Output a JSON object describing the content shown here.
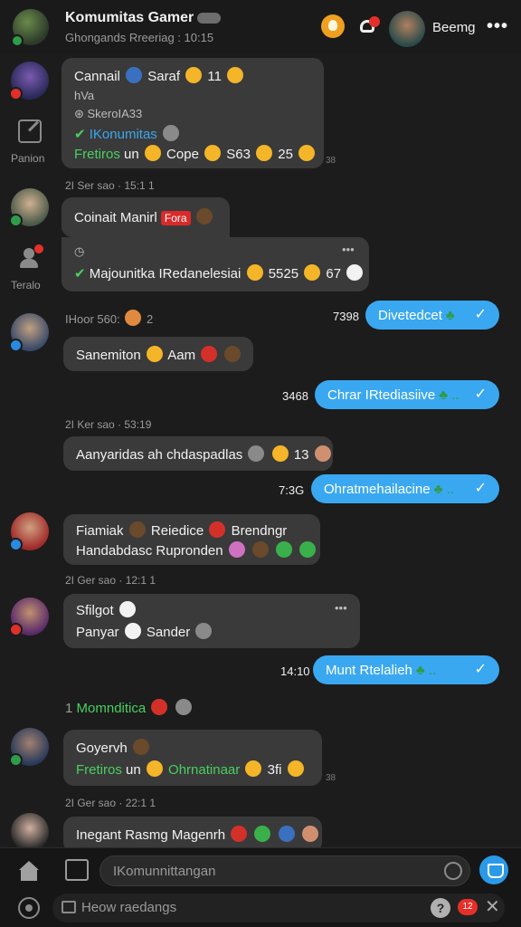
{
  "header": {
    "title": "Komumitas Gamer",
    "subtitle": "Ghongands Rreeriag : 10:15",
    "user_name": "Beemg",
    "more": "•••"
  },
  "rail": {
    "edit_label": "Panion",
    "people_label": "Teralo"
  },
  "messages": {
    "m1": {
      "line1_a": "Cannail",
      "line1_b": "Saraf",
      "line1_c": "11",
      "line2": "hVa",
      "line3": "SkeroIA33",
      "line4": "IKonumitas",
      "line5_a": "Fretiros",
      "line5_b": "un",
      "line5_c": "Cope",
      "line5_d": "S63",
      "line5_e": "25",
      "time": "38"
    },
    "m2_meta": "2I Ser sao · 15:1 1",
    "m2": {
      "line1": "Coinait Manirl",
      "tag": "Fora",
      "line3_a": "Majounitka IRedanelesiai",
      "line3_b": "5525",
      "line3_c": "67",
      "more": "•••"
    },
    "m3_meta_a": "IHoor 560:",
    "m3_meta_b": "2",
    "m3_out": {
      "time": "7398",
      "text": "Divetedcet",
      "check": "✓"
    },
    "m4": {
      "line1_a": "Sanemiton",
      "line1_b": "Aam"
    },
    "m5_out": {
      "time": "3468",
      "text": "Chrar IRtediasiive",
      "check": "✓"
    },
    "m6_meta": "2I Ker sao · 53:19",
    "m6": {
      "line1_a": "Aanyaridas ah chdaspadlas",
      "line1_b": "13"
    },
    "m7_out": {
      "time": "7:3G",
      "text": "Ohratmehailacine",
      "check": "✓"
    },
    "m8": {
      "line1_a": "Fiamiak",
      "line1_b": "Reiedice",
      "line1_c": "Brendngr",
      "line2": "Handabdasc Rupronden"
    },
    "m9_meta": "2I Ger sao · 12:1 1",
    "m9": {
      "line1": "Sfilgot",
      "line2_a": "Panyar",
      "line2_b": "Sander",
      "more": "•••"
    },
    "m10_out": {
      "time": "14:10",
      "text": "Munt Rtelalieh",
      "check": "✓"
    },
    "m11_meta_a": "1",
    "m11_meta_b": "Momnditica",
    "m12": {
      "line1": "Goyervh",
      "line2_a": "Fretiros",
      "line2_b": "un",
      "line2_c": "Ohrnatinaar",
      "line2_d": "3fi",
      "time": "38"
    },
    "m13_meta": "2I Ger sao · 22:1 1",
    "m14": {
      "line1": "Inegant Rasmg Magenrh"
    }
  },
  "composer": {
    "input_placeholder": "IKomunnittangan",
    "search_placeholder": "Heow raedangs",
    "help": "?",
    "notif_count": "12",
    "close": "✕"
  }
}
